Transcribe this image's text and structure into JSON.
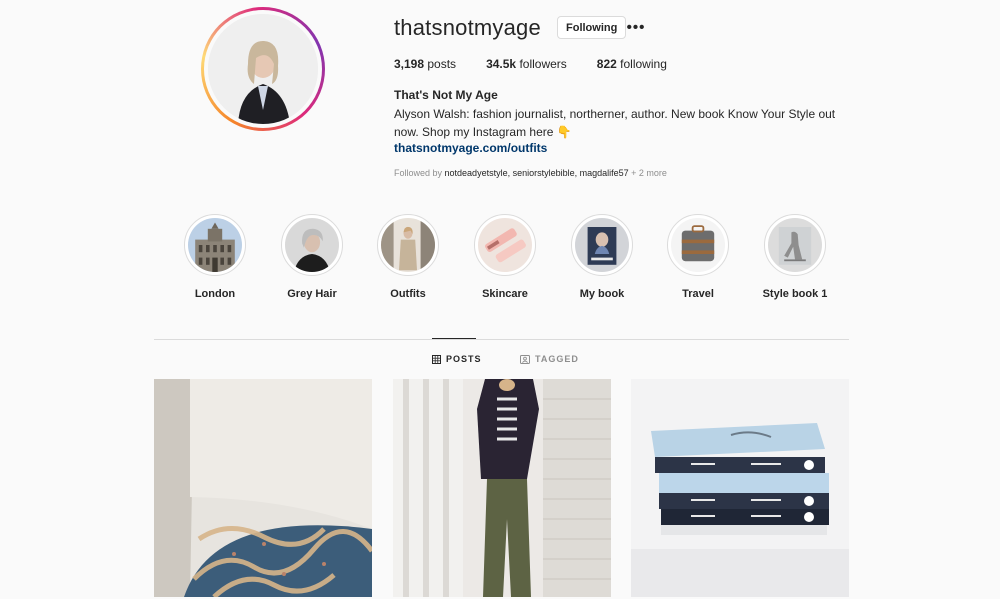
{
  "profile": {
    "username": "thatsnotmyage",
    "follow_button_label": "Following",
    "more_label": "•••",
    "stats": {
      "posts_count": "3,198",
      "posts_label": "posts",
      "followers_count": "34.5k",
      "followers_label": "followers",
      "following_count": "822",
      "following_label": "following"
    },
    "full_name": "That's Not My Age",
    "bio": "Alyson Walsh: fashion journalist, northerner, author. New book Know Your Style out now. Shop my Instagram here 👇",
    "link": "thatsnotmyage.com/outfits",
    "followed_by": {
      "prefix": "Followed by ",
      "names": "notdeadyetstyle, seniorstylebible, magdalife57",
      "suffix": " + 2 more"
    }
  },
  "highlights": [
    {
      "label": "London"
    },
    {
      "label": "Grey Hair"
    },
    {
      "label": "Outfits"
    },
    {
      "label": "Skincare"
    },
    {
      "label": "My book"
    },
    {
      "label": "Travel"
    },
    {
      "label": "Style book 1"
    }
  ],
  "tabs": {
    "posts": "POSTS",
    "tagged": "TAGGED"
  },
  "colors": {
    "link": "#00376b",
    "secondary_text": "#8e8e8e",
    "primary_text": "#262626"
  }
}
